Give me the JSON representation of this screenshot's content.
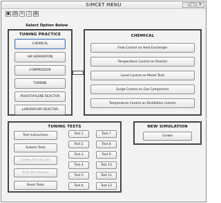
{
  "window": {
    "title": "SIMCET MENU",
    "minimize": "–",
    "maximize": "□",
    "close": "✕"
  },
  "toolbar": {
    "icons": [
      "open-icon",
      "chart-icon",
      "tune-icon",
      "music-icon",
      "page-icon"
    ],
    "glyphs": [
      "▣",
      "▥",
      "≋",
      "♫",
      "▤"
    ]
  },
  "select_label": "Select Option Below",
  "tuning_practice": {
    "title": "TUNING PRACTICE",
    "items": [
      "CHEMICAL",
      "AIR SEPARATION",
      "COMPRESSOR",
      "TURBINE",
      "POLYETHYLENE REACTOR",
      "LABORATORY REACTOR"
    ]
  },
  "chemical": {
    "title": "CHEMICAL",
    "items": [
      "Flow Control on Heat Exchanger",
      "Temperature Control on Reactor",
      "Level Control on Mixed Tank",
      "Surge Control on Gas Compressor",
      "Temperature Control on Distillation Column"
    ]
  },
  "tuning_tests": {
    "title": "TUNING TESTS",
    "actions": [
      "Test Instructions",
      "Submit Tests",
      "Delete Test Results",
      "Print Test Results",
      "Reset Tests"
    ],
    "tests": [
      "Test 1",
      "Test 2",
      "Test 3",
      "Test 4",
      "Test 5",
      "Test 6",
      "Test 7",
      "Test 8",
      "Test 9",
      "Test 10",
      "Test 11",
      "Test 12"
    ]
  },
  "new_simulation": {
    "title": "NEW SIMULATION",
    "create_label": "Create"
  }
}
